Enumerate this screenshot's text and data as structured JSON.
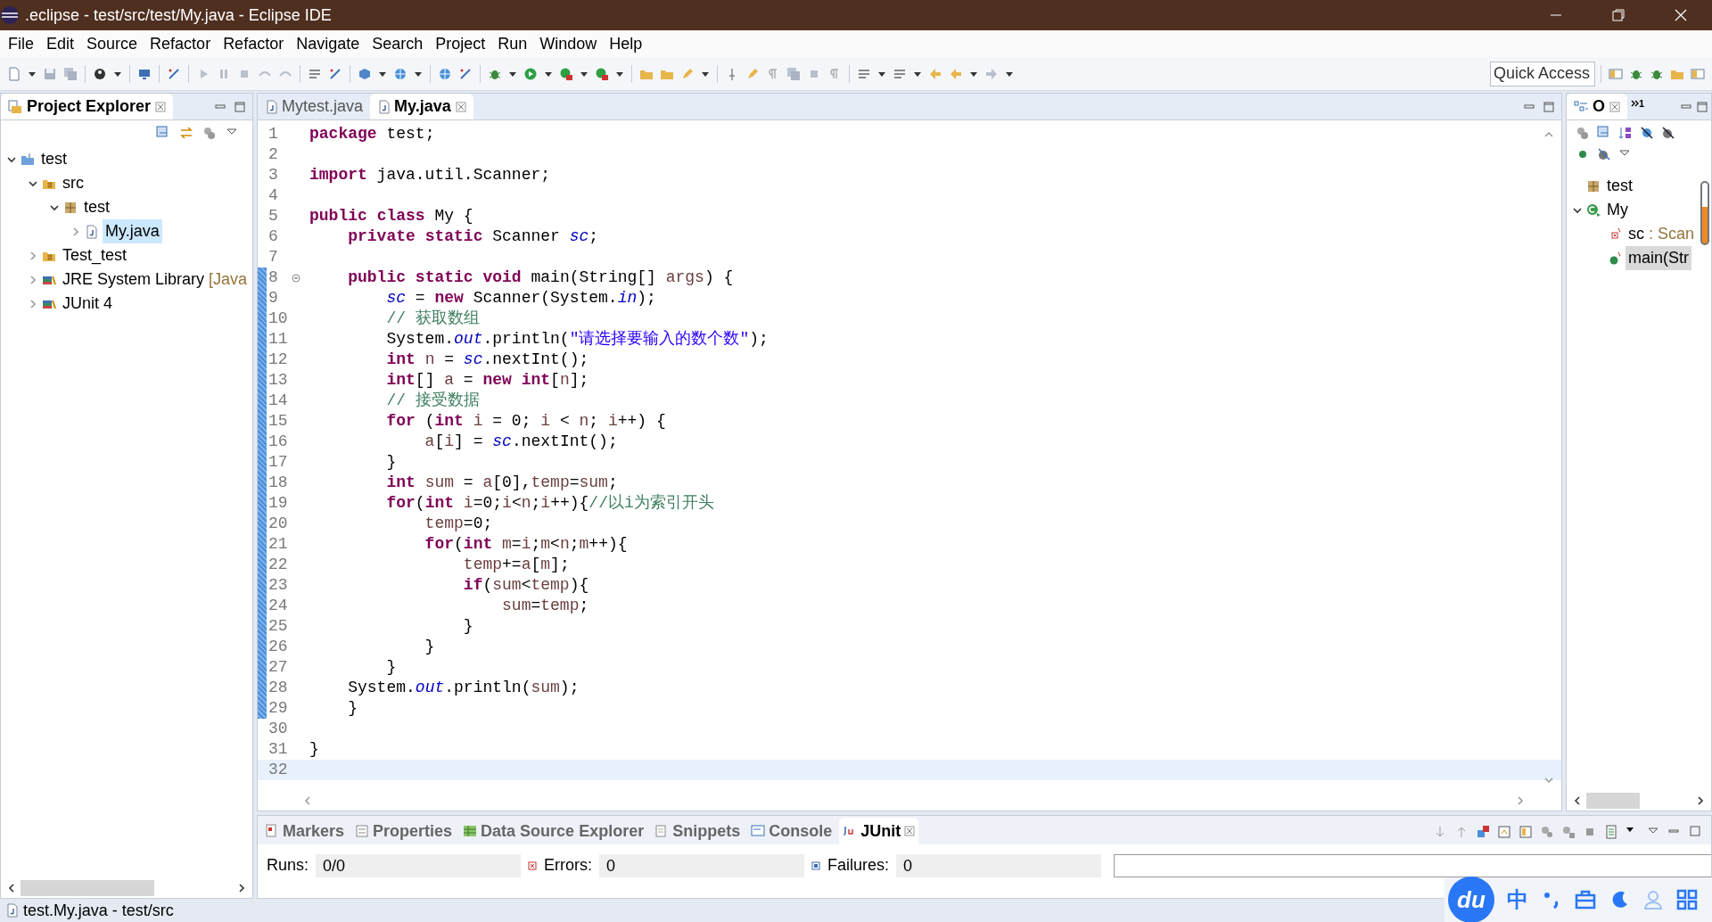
{
  "window": {
    "title": ".eclipse - test/src/test/My.java - Eclipse IDE"
  },
  "menu": [
    "File",
    "Edit",
    "Source",
    "Refactor",
    "Refactor",
    "Navigate",
    "Search",
    "Project",
    "Run",
    "Window",
    "Help"
  ],
  "toolbar": {
    "quick_access": {
      "placeholder": "Quick Access"
    }
  },
  "project_explorer": {
    "title": "Project Explorer",
    "tree": [
      {
        "label": "test",
        "kind": "project",
        "expanded": true,
        "selected": false,
        "children": [
          {
            "label": "src",
            "kind": "source_folder",
            "expanded": true,
            "selected": false,
            "children": [
              {
                "label": "test",
                "kind": "package",
                "expanded": true,
                "selected": false,
                "children": [
                  {
                    "label": "My.java",
                    "kind": "java_file",
                    "expanded": false,
                    "selected": true
                  }
                ]
              }
            ]
          },
          {
            "label": "Test_test",
            "kind": "source_folder",
            "expanded": false,
            "selected": false
          },
          {
            "label": "JRE System Library",
            "decoration": "[Java",
            "kind": "library",
            "expanded": false,
            "selected": false
          },
          {
            "label": "JUnit 4",
            "kind": "library",
            "expanded": false,
            "selected": false
          }
        ]
      }
    ]
  },
  "editor": {
    "tabs": [
      {
        "label": "Mytest.java",
        "selected": false
      },
      {
        "label": "My.java",
        "selected": true
      }
    ],
    "lines": [
      {
        "number": "1",
        "in_range": false,
        "current": false,
        "foldable": false,
        "tokens": [
          {
            "kind": "keyword",
            "text": "package"
          },
          {
            "kind": "plain",
            "text": " test;"
          }
        ]
      },
      {
        "number": "2",
        "in_range": false,
        "current": false,
        "foldable": false
      },
      {
        "number": "3",
        "in_range": false,
        "current": false,
        "foldable": false,
        "tokens": [
          {
            "kind": "keyword",
            "text": "import"
          },
          {
            "kind": "plain",
            "text": " java.util.Scanner;"
          }
        ]
      },
      {
        "number": "4",
        "in_range": false,
        "current": false,
        "foldable": false
      },
      {
        "number": "5",
        "in_range": false,
        "current": false,
        "foldable": false,
        "tokens": [
          {
            "kind": "keyword",
            "text": "public "
          },
          {
            "kind": "keyword",
            "text": "class"
          },
          {
            "kind": "plain",
            "text": " My {"
          }
        ]
      },
      {
        "number": "6",
        "in_range": false,
        "current": false,
        "foldable": false,
        "tokens": [
          {
            "kind": "keyword",
            "text": "    private "
          },
          {
            "kind": "keyword",
            "text": "static"
          },
          {
            "kind": "plain",
            "text": " Scanner "
          },
          {
            "kind": "static_field",
            "text": "sc"
          },
          {
            "kind": "plain",
            "text": ";"
          }
        ]
      },
      {
        "number": "7",
        "in_range": false,
        "current": false,
        "foldable": false
      },
      {
        "number": "8",
        "in_range": true,
        "current": false,
        "foldable": true,
        "tokens": [
          {
            "kind": "keyword",
            "text": "    public "
          },
          {
            "kind": "keyword",
            "text": "static "
          },
          {
            "kind": "keyword",
            "text": "void"
          },
          {
            "kind": "plain",
            "text": " main(String[] "
          },
          {
            "kind": "local",
            "text": "args"
          },
          {
            "kind": "plain",
            "text": ") {"
          }
        ]
      },
      {
        "number": "9",
        "in_range": true,
        "current": false,
        "foldable": false,
        "tokens": [
          {
            "kind": "static_field",
            "text": "        sc"
          },
          {
            "kind": "plain",
            "text": " = "
          },
          {
            "kind": "keyword",
            "text": "new"
          },
          {
            "kind": "plain",
            "text": " Scanner(System."
          },
          {
            "kind": "static_field",
            "text": "in"
          },
          {
            "kind": "plain",
            "text": ");"
          }
        ]
      },
      {
        "number": "10",
        "in_range": true,
        "current": false,
        "foldable": false,
        "tokens": [
          {
            "kind": "comment",
            "text": "        // 获取数组"
          }
        ]
      },
      {
        "number": "11",
        "in_range": true,
        "current": false,
        "foldable": false,
        "tokens": [
          {
            "kind": "plain",
            "text": "        System."
          },
          {
            "kind": "static_field",
            "text": "out"
          },
          {
            "kind": "plain",
            "text": ".println("
          },
          {
            "kind": "string",
            "text": "\"请选择要输入的数个数\""
          },
          {
            "kind": "plain",
            "text": ");"
          }
        ]
      },
      {
        "number": "12",
        "in_range": true,
        "current": false,
        "foldable": false,
        "tokens": [
          {
            "kind": "keyword",
            "text": "        int"
          },
          {
            "kind": "local",
            "text": " n"
          },
          {
            "kind": "plain",
            "text": " = "
          },
          {
            "kind": "static_field",
            "text": "sc"
          },
          {
            "kind": "plain",
            "text": ".nextInt();"
          }
        ]
      },
      {
        "number": "13",
        "in_range": true,
        "current": false,
        "foldable": false,
        "tokens": [
          {
            "kind": "keyword",
            "text": "        int"
          },
          {
            "kind": "plain",
            "text": "[] "
          },
          {
            "kind": "local",
            "text": "a"
          },
          {
            "kind": "plain",
            "text": " = "
          },
          {
            "kind": "keyword",
            "text": "new "
          },
          {
            "kind": "keyword",
            "text": "int"
          },
          {
            "kind": "plain",
            "text": "["
          },
          {
            "kind": "local",
            "text": "n"
          },
          {
            "kind": "plain",
            "text": "];"
          }
        ]
      },
      {
        "number": "14",
        "in_range": true,
        "current": false,
        "foldable": false,
        "tokens": [
          {
            "kind": "comment",
            "text": "        // 接受数据"
          }
        ]
      },
      {
        "number": "15",
        "in_range": true,
        "current": false,
        "foldable": false,
        "tokens": [
          {
            "kind": "keyword",
            "text": "        for"
          },
          {
            "kind": "plain",
            "text": " ("
          },
          {
            "kind": "keyword",
            "text": "int"
          },
          {
            "kind": "local",
            "text": " i"
          },
          {
            "kind": "plain",
            "text": " = 0; "
          },
          {
            "kind": "local",
            "text": "i"
          },
          {
            "kind": "plain",
            "text": " < "
          },
          {
            "kind": "local",
            "text": "n"
          },
          {
            "kind": "plain",
            "text": "; "
          },
          {
            "kind": "local",
            "text": "i"
          },
          {
            "kind": "plain",
            "text": "++) {"
          }
        ]
      },
      {
        "number": "16",
        "in_range": true,
        "current": false,
        "foldable": false,
        "tokens": [
          {
            "kind": "local",
            "text": "            a"
          },
          {
            "kind": "plain",
            "text": "["
          },
          {
            "kind": "local",
            "text": "i"
          },
          {
            "kind": "plain",
            "text": "] = "
          },
          {
            "kind": "static_field",
            "text": "sc"
          },
          {
            "kind": "plain",
            "text": ".nextInt();"
          }
        ]
      },
      {
        "number": "17",
        "in_range": true,
        "current": false,
        "foldable": false,
        "tokens": [
          {
            "kind": "plain",
            "text": "        }"
          }
        ]
      },
      {
        "number": "18",
        "in_range": true,
        "current": false,
        "foldable": false,
        "tokens": [
          {
            "kind": "keyword",
            "text": "        int"
          },
          {
            "kind": "local",
            "text": " sum"
          },
          {
            "kind": "plain",
            "text": " = "
          },
          {
            "kind": "local",
            "text": "a"
          },
          {
            "kind": "plain",
            "text": "[0],"
          },
          {
            "kind": "local",
            "text": "temp"
          },
          {
            "kind": "plain",
            "text": "="
          },
          {
            "kind": "local",
            "text": "sum"
          },
          {
            "kind": "plain",
            "text": ";"
          }
        ]
      },
      {
        "number": "19",
        "in_range": true,
        "current": false,
        "foldable": false,
        "tokens": [
          {
            "kind": "keyword",
            "text": "        for"
          },
          {
            "kind": "plain",
            "text": "("
          },
          {
            "kind": "keyword",
            "text": "int"
          },
          {
            "kind": "local",
            "text": " i"
          },
          {
            "kind": "plain",
            "text": "=0;"
          },
          {
            "kind": "local",
            "text": "i"
          },
          {
            "kind": "plain",
            "text": "<"
          },
          {
            "kind": "local",
            "text": "n"
          },
          {
            "kind": "plain",
            "text": ";"
          },
          {
            "kind": "local",
            "text": "i"
          },
          {
            "kind": "plain",
            "text": "++){"
          },
          {
            "kind": "comment",
            "text": "//以i为索引开头"
          }
        ]
      },
      {
        "number": "20",
        "in_range": true,
        "current": false,
        "foldable": false,
        "tokens": [
          {
            "kind": "local",
            "text": "            temp"
          },
          {
            "kind": "plain",
            "text": "=0;"
          }
        ]
      },
      {
        "number": "21",
        "in_range": true,
        "current": false,
        "foldable": false,
        "tokens": [
          {
            "kind": "keyword",
            "text": "            for"
          },
          {
            "kind": "plain",
            "text": "("
          },
          {
            "kind": "keyword",
            "text": "int"
          },
          {
            "kind": "local",
            "text": " m"
          },
          {
            "kind": "plain",
            "text": "="
          },
          {
            "kind": "local",
            "text": "i"
          },
          {
            "kind": "plain",
            "text": ";"
          },
          {
            "kind": "local",
            "text": "m"
          },
          {
            "kind": "plain",
            "text": "<"
          },
          {
            "kind": "local",
            "text": "n"
          },
          {
            "kind": "plain",
            "text": ";"
          },
          {
            "kind": "local",
            "text": "m"
          },
          {
            "kind": "plain",
            "text": "++){"
          }
        ]
      },
      {
        "number": "22",
        "in_range": true,
        "current": false,
        "foldable": false,
        "tokens": [
          {
            "kind": "local",
            "text": "                temp"
          },
          {
            "kind": "plain",
            "text": "+="
          },
          {
            "kind": "local",
            "text": "a"
          },
          {
            "kind": "plain",
            "text": "["
          },
          {
            "kind": "local",
            "text": "m"
          },
          {
            "kind": "plain",
            "text": "];"
          }
        ]
      },
      {
        "number": "23",
        "in_range": true,
        "current": false,
        "foldable": false,
        "tokens": [
          {
            "kind": "keyword",
            "text": "                if"
          },
          {
            "kind": "plain",
            "text": "("
          },
          {
            "kind": "local",
            "text": "sum"
          },
          {
            "kind": "plain",
            "text": "<"
          },
          {
            "kind": "local",
            "text": "temp"
          },
          {
            "kind": "plain",
            "text": "){"
          }
        ]
      },
      {
        "number": "24",
        "in_range": true,
        "current": false,
        "foldable": false,
        "tokens": [
          {
            "kind": "local",
            "text": "                    sum"
          },
          {
            "kind": "plain",
            "text": "="
          },
          {
            "kind": "local",
            "text": "temp"
          },
          {
            "kind": "plain",
            "text": ";"
          }
        ]
      },
      {
        "number": "25",
        "in_range": true,
        "current": false,
        "foldable": false,
        "tokens": [
          {
            "kind": "plain",
            "text": "                }"
          }
        ]
      },
      {
        "number": "26",
        "in_range": true,
        "current": false,
        "foldable": false,
        "tokens": [
          {
            "kind": "plain",
            "text": "            }"
          }
        ]
      },
      {
        "number": "27",
        "in_range": true,
        "current": false,
        "foldable": false,
        "tokens": [
          {
            "kind": "plain",
            "text": "        }"
          }
        ]
      },
      {
        "number": "28",
        "in_range": true,
        "current": false,
        "foldable": false,
        "tokens": [
          {
            "kind": "plain",
            "text": "    System."
          },
          {
            "kind": "static_field",
            "text": "out"
          },
          {
            "kind": "plain",
            "text": ".println("
          },
          {
            "kind": "local",
            "text": "sum"
          },
          {
            "kind": "plain",
            "text": ");"
          }
        ]
      },
      {
        "number": "29",
        "in_range": true,
        "current": false,
        "foldable": false,
        "tokens": [
          {
            "kind": "plain",
            "text": "    }"
          }
        ]
      },
      {
        "number": "30",
        "in_range": false,
        "current": false,
        "foldable": false
      },
      {
        "number": "31",
        "in_range": false,
        "current": false,
        "foldable": false,
        "tokens": [
          {
            "kind": "plain",
            "text": "}"
          }
        ]
      },
      {
        "number": "32",
        "in_range": false,
        "current": true,
        "foldable": false
      }
    ]
  },
  "outline": {
    "tab": "O",
    "overflow": "1",
    "items": [
      {
        "label": "test",
        "kind": "package",
        "selected": false
      },
      {
        "label": "My",
        "kind": "class",
        "expanded": true,
        "selected": false,
        "children": [
          {
            "label": "sc",
            "type": " : Scan",
            "kind": "field",
            "selected": false
          },
          {
            "label": "main(Str",
            "kind": "method",
            "selected": true
          }
        ]
      }
    ]
  },
  "bottom_panel": {
    "tabs": [
      {
        "label": "Markers",
        "kind": "markers",
        "selected": false
      },
      {
        "label": "Properties",
        "kind": "properties",
        "selected": false
      },
      {
        "label": "Data Source Explorer",
        "kind": "datasource",
        "selected": false
      },
      {
        "label": "Snippets",
        "kind": "snippets",
        "selected": false
      },
      {
        "label": "Console",
        "kind": "console",
        "selected": false
      },
      {
        "label": "JUnit",
        "kind": "junit",
        "selected": true
      }
    ],
    "junit": {
      "runs_label": "Runs:",
      "runs": "0/0",
      "errors_label": "Errors:",
      "errors": "0",
      "failures_label": "Failures:",
      "failures": "0",
      "level": 0
    }
  },
  "status_bar": {
    "text": "test.My.java - test/src"
  },
  "ime": {
    "logo": "du",
    "mode": "中"
  }
}
